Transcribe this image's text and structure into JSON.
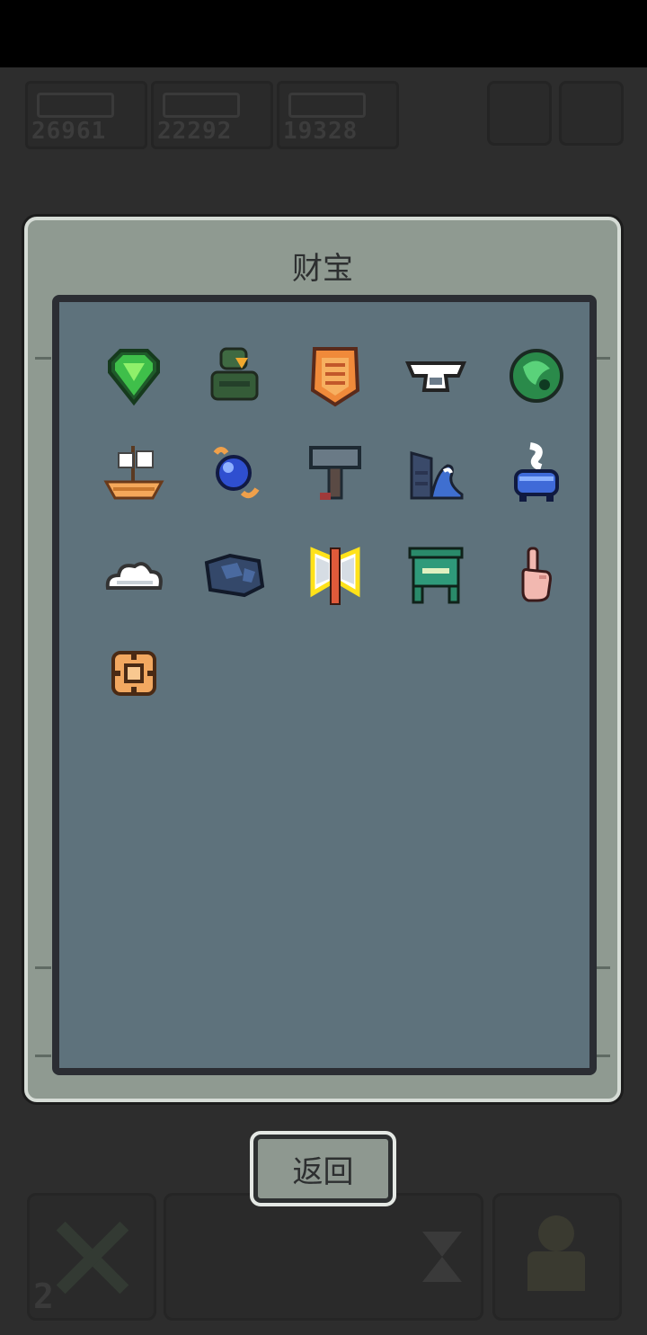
{
  "dialog": {
    "title": "财宝"
  },
  "buttons": {
    "return_label": "返回"
  },
  "hud": {
    "resources": [
      "26961",
      "22292",
      "19328"
    ],
    "bottom_left_count": "2"
  },
  "treasures": [
    {
      "icon": "green-gem-icon"
    },
    {
      "icon": "green-soldier-icon"
    },
    {
      "icon": "orange-armor-icon"
    },
    {
      "icon": "anvil-icon"
    },
    {
      "icon": "green-dragon-icon"
    },
    {
      "icon": "sailing-ship-icon"
    },
    {
      "icon": "blue-orb-icon"
    },
    {
      "icon": "war-hammer-icon"
    },
    {
      "icon": "wave-wall-icon"
    },
    {
      "icon": "blue-cauldron-icon"
    },
    {
      "icon": "white-cloud-icon"
    },
    {
      "icon": "blue-rock-icon"
    },
    {
      "icon": "double-axe-icon"
    },
    {
      "icon": "green-shrine-icon"
    },
    {
      "icon": "pointing-hand-icon"
    },
    {
      "icon": "orange-ring-icon"
    }
  ],
  "colors": {
    "dialog_bg": "#8f9a91",
    "inner_bg": "#5e727c",
    "selected_outline": "#ffe21a"
  }
}
